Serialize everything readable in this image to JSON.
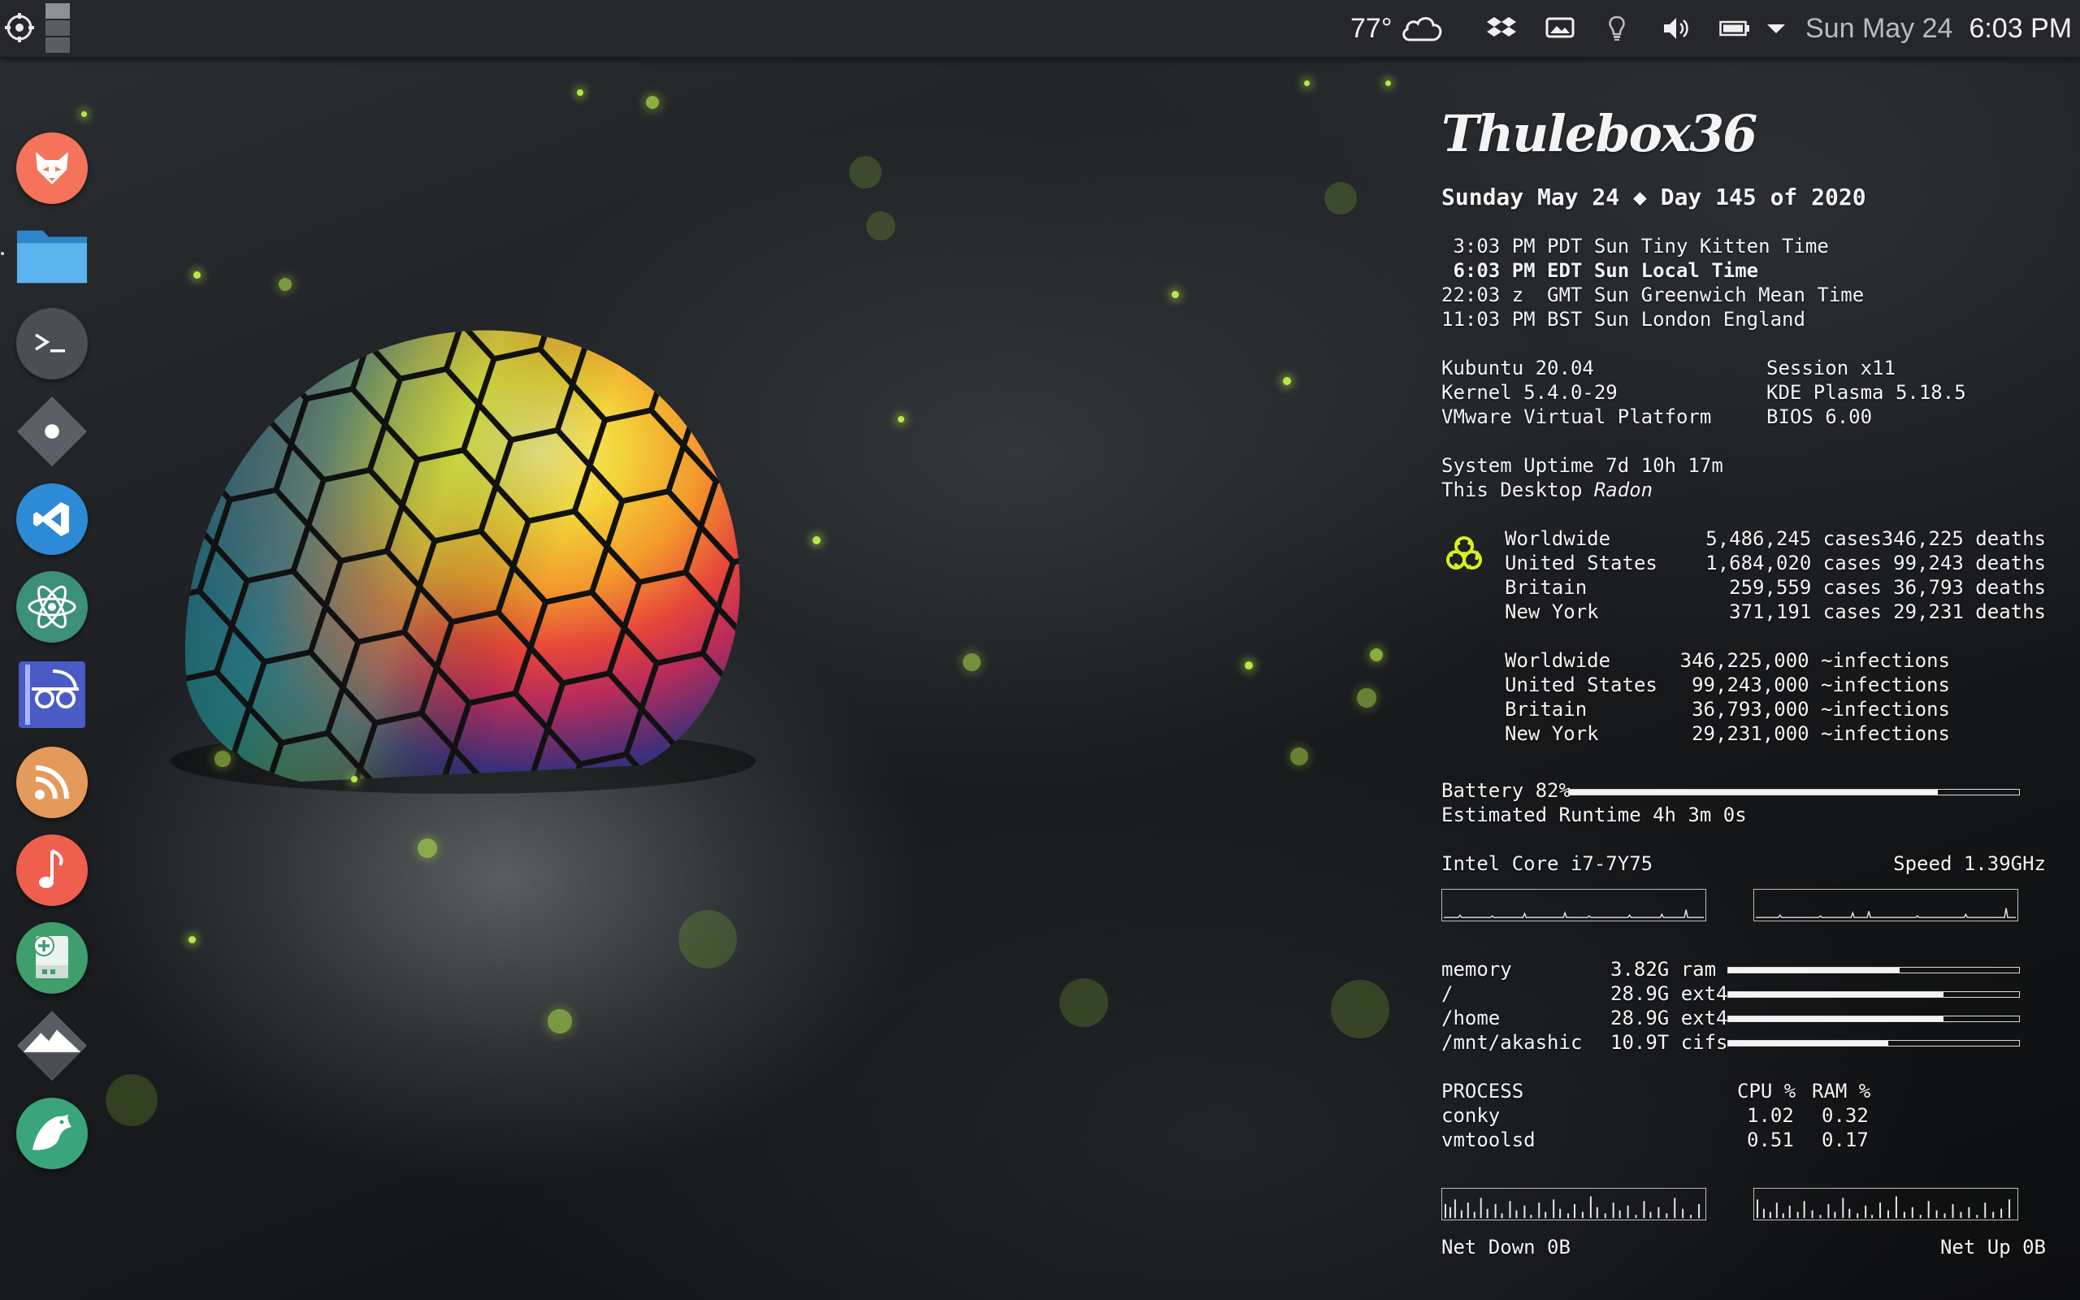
{
  "panel": {
    "temperature": "77°",
    "weather_icon": "cloud-icon",
    "date": "Sun May 24",
    "time": "6:03 PM",
    "tray_icons": [
      "dropbox-icon",
      "display-icon",
      "bulb-icon",
      "volume-icon",
      "battery-icon",
      "chevron-down-icon"
    ]
  },
  "dock": {
    "items": [
      {
        "name": "firefox",
        "icon": "fox-icon",
        "color": "#f4735a"
      },
      {
        "name": "files",
        "icon": "folder-icon",
        "color": "#3d9ee0"
      },
      {
        "name": "terminal",
        "icon": "terminal-icon",
        "color": "#4a4f55"
      },
      {
        "name": "settings",
        "icon": "diamond-dot-icon",
        "color": "#5c6066"
      },
      {
        "name": "vscode",
        "icon": "vscode-icon",
        "color": "#2c8ad6"
      },
      {
        "name": "atom",
        "icon": "atom-icon",
        "color": "#3c8f78"
      },
      {
        "name": "reader",
        "icon": "reader-icon",
        "color": "#4a5bc5"
      },
      {
        "name": "rss",
        "icon": "rss-icon",
        "color": "#e39a5a"
      },
      {
        "name": "music",
        "icon": "music-note-icon",
        "color": "#ef5f4d"
      },
      {
        "name": "usb-creator",
        "icon": "drive-add-icon",
        "color": "#3e9e6c"
      },
      {
        "name": "mountain",
        "icon": "mountain-icon",
        "color": "#5a5e64"
      },
      {
        "name": "dragon",
        "icon": "dragon-icon",
        "color": "#3aa47a"
      }
    ]
  },
  "conky": {
    "host": "Thulebox36",
    "date_line": "Sunday May 24 ◆ Day 145 of 2020",
    "zones": [
      {
        "text": " 3:03 PM PDT Sun Tiny Kitten Time",
        "bold": false
      },
      {
        "text": " 6:03 PM EDT Sun Local Time",
        "bold": true
      },
      {
        "text": "22:03 z  GMT Sun Greenwich Mean Time",
        "bold": false
      },
      {
        "text": "11:03 PM BST Sun London England",
        "bold": false
      }
    ],
    "sys_left": [
      "Kubuntu 20.04",
      "Kernel 5.4.0-29",
      "VMware Virtual Platform"
    ],
    "sys_right": [
      "Session x11",
      "KDE Plasma 5.18.5",
      "BIOS 6.00"
    ],
    "uptime": "System Uptime 7d 10h 17m",
    "desktop_label": "This Desktop ",
    "desktop_name": "Radon",
    "covid_cases": [
      {
        "region": "Worldwide",
        "cases": "5,486,245 cases",
        "deaths": "346,225 deaths"
      },
      {
        "region": "United States",
        "cases": "1,684,020 cases",
        "deaths": "99,243 deaths"
      },
      {
        "region": "Britain",
        "cases": "259,559 cases",
        "deaths": "36,793 deaths"
      },
      {
        "region": "New York",
        "cases": "371,191 cases",
        "deaths": "29,231 deaths"
      }
    ],
    "covid_infections": [
      {
        "region": "Worldwide",
        "value": "346,225,000 ~infections"
      },
      {
        "region": "United States",
        "value": "99,243,000 ~infections"
      },
      {
        "region": "Britain",
        "value": "36,793,000 ~infections"
      },
      {
        "region": "New York",
        "value": "29,231,000 ~infections"
      }
    ],
    "battery_label": "Battery 82%",
    "battery_level": 0.82,
    "runtime": "Estimated Runtime 4h 3m 0s",
    "cpu_name": "Intel Core i7-7Y75",
    "cpu_speed": "Speed 1.39GHz",
    "storage": [
      {
        "name": "memory",
        "size": "3.82G ram",
        "level": 0.59
      },
      {
        "name": "/",
        "size": "28.9G ext4",
        "level": 0.74
      },
      {
        "name": "/home",
        "size": "28.9G ext4",
        "level": 0.74
      },
      {
        "name": "/mnt/akashic",
        "size": "10.9T cifs",
        "level": 0.55
      }
    ],
    "process_header": [
      "PROCESS",
      "CPU %",
      "RAM %"
    ],
    "processes": [
      {
        "name": "conky",
        "cpu": "1.02",
        "ram": "0.32"
      },
      {
        "name": "vmtoolsd",
        "cpu": "0.51",
        "ram": "0.17"
      }
    ],
    "net_down": "Net Down 0B",
    "net_up": "Net Up 0B"
  }
}
